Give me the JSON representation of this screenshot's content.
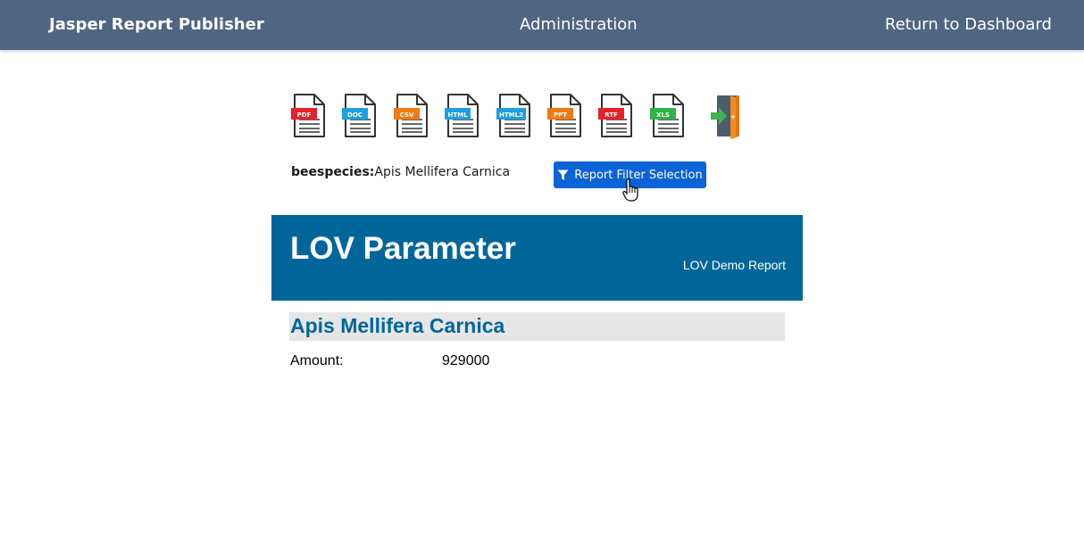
{
  "navbar": {
    "brand": "Jasper Report Publisher",
    "admin_link": "Administration",
    "return_link": "Return to Dashboard",
    "background_color": "#4f6580"
  },
  "exports": [
    {
      "label": "PDF",
      "color": "#e8202a",
      "icon": "pdf-file-icon"
    },
    {
      "label": "DOC",
      "color": "#1f9fe0",
      "icon": "doc-file-icon"
    },
    {
      "label": "CSV",
      "color": "#f07a14",
      "icon": "csv-file-icon"
    },
    {
      "label": "HTML",
      "color": "#1f9fe0",
      "icon": "html-file-icon"
    },
    {
      "label": "HTML2",
      "color": "#1f9fe0",
      "icon": "html2-file-icon"
    },
    {
      "label": "PPT",
      "color": "#f07a14",
      "icon": "ppt-file-icon"
    },
    {
      "label": "RTF",
      "color": "#e8202a",
      "icon": "rtf-file-icon"
    },
    {
      "label": "XLS",
      "color": "#2db34a",
      "icon": "xls-file-icon"
    }
  ],
  "exit_icon": "exit-door-icon",
  "parameter": {
    "name": "beespecies:",
    "value": "Apis Mellifera Carnica"
  },
  "filter_button": {
    "label": "Report Filter Selection",
    "icon": "filter-icon",
    "color": "#0b63d6"
  },
  "report": {
    "title": "LOV Parameter",
    "subtitle": "LOV Demo Report",
    "header_color": "#006699",
    "group_title": "Apis Mellifera Carnica",
    "amount_label": "Amount:",
    "amount_value": "929000"
  }
}
